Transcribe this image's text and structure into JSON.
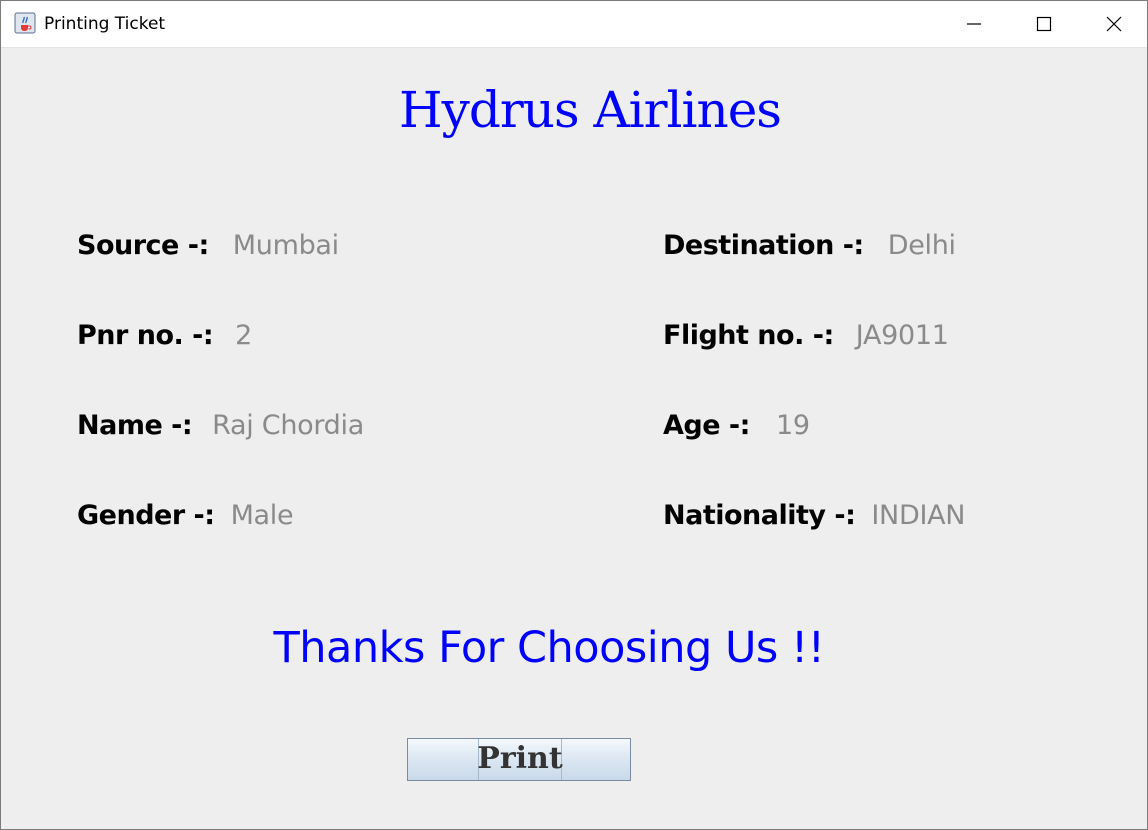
{
  "window": {
    "title": "Printing Ticket"
  },
  "ticket": {
    "airline": "Hydrus Airlines",
    "source": {
      "label": "Source -:",
      "value": "Mumbai"
    },
    "destination": {
      "label": "Destination -:",
      "value": "Delhi"
    },
    "pnr": {
      "label": "Pnr no. -:",
      "value": "2"
    },
    "flight": {
      "label": "Flight no. -:",
      "value": "JA9011"
    },
    "name": {
      "label": "Name -:",
      "value": "Raj Chordia"
    },
    "age": {
      "label": "Age -:",
      "value": "19"
    },
    "gender": {
      "label": "Gender -:",
      "value": "Male"
    },
    "nationality": {
      "label": "Nationality -:",
      "value": "INDIAN"
    },
    "thanks": "Thanks For Choosing Us !!",
    "print_label": "Print"
  },
  "colors": {
    "title": "#0000ff",
    "value_text": "#8a8a8a",
    "background": "#eeeeee"
  },
  "icons": {
    "app": "java-cup-icon",
    "minimize": "minimize-icon",
    "maximize": "maximize-icon",
    "close": "close-icon"
  }
}
